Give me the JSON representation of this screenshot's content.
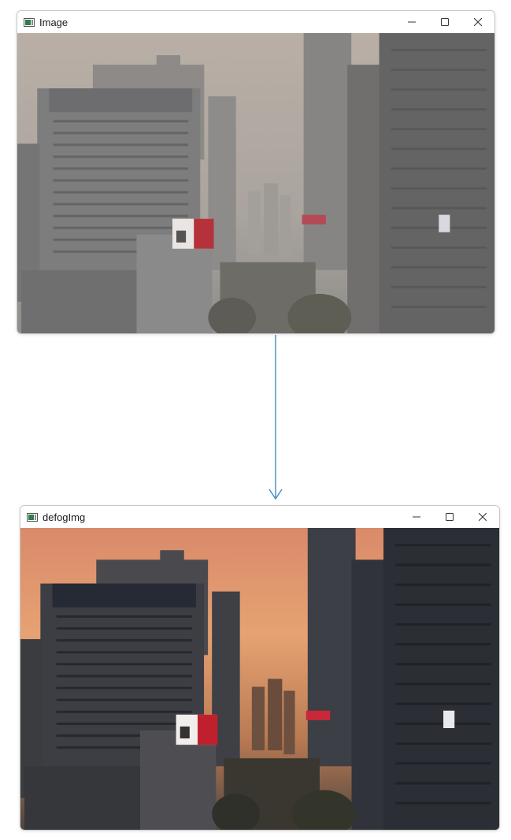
{
  "windows": {
    "original": {
      "title": "Image"
    },
    "defogged": {
      "title": "defogImg"
    }
  },
  "icons": {
    "app": "image-window-icon",
    "minimize": "minimize-icon",
    "maximize": "maximize-icon",
    "close": "close-icon"
  },
  "colors": {
    "arrow": "#4a90c8",
    "fog_sky": "#b7aca2",
    "defog_sky": "#e8a070"
  }
}
